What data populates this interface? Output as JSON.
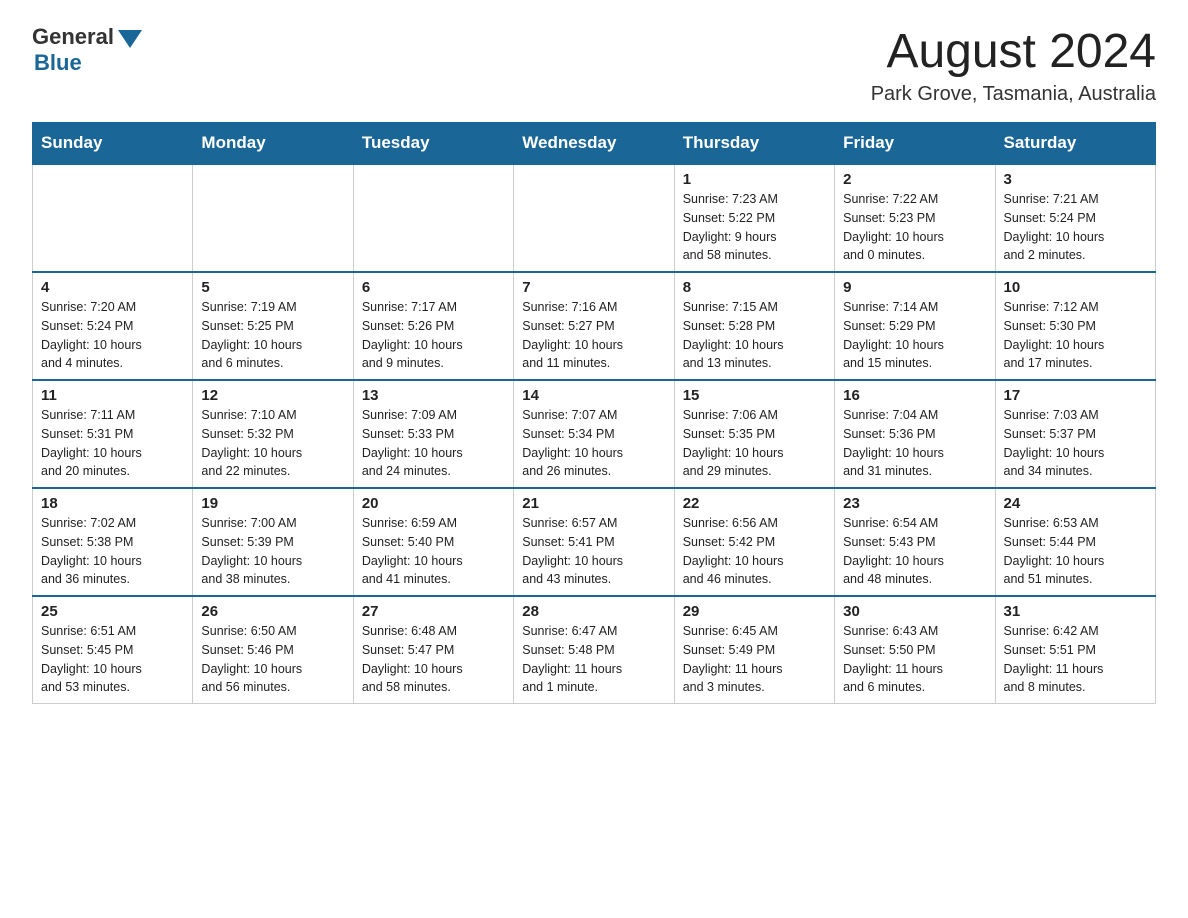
{
  "logo": {
    "general": "General",
    "blue": "Blue"
  },
  "header": {
    "month": "August 2024",
    "location": "Park Grove, Tasmania, Australia"
  },
  "days_of_week": [
    "Sunday",
    "Monday",
    "Tuesday",
    "Wednesday",
    "Thursday",
    "Friday",
    "Saturday"
  ],
  "weeks": [
    [
      {
        "day": "",
        "info": ""
      },
      {
        "day": "",
        "info": ""
      },
      {
        "day": "",
        "info": ""
      },
      {
        "day": "",
        "info": ""
      },
      {
        "day": "1",
        "info": "Sunrise: 7:23 AM\nSunset: 5:22 PM\nDaylight: 9 hours\nand 58 minutes."
      },
      {
        "day": "2",
        "info": "Sunrise: 7:22 AM\nSunset: 5:23 PM\nDaylight: 10 hours\nand 0 minutes."
      },
      {
        "day": "3",
        "info": "Sunrise: 7:21 AM\nSunset: 5:24 PM\nDaylight: 10 hours\nand 2 minutes."
      }
    ],
    [
      {
        "day": "4",
        "info": "Sunrise: 7:20 AM\nSunset: 5:24 PM\nDaylight: 10 hours\nand 4 minutes."
      },
      {
        "day": "5",
        "info": "Sunrise: 7:19 AM\nSunset: 5:25 PM\nDaylight: 10 hours\nand 6 minutes."
      },
      {
        "day": "6",
        "info": "Sunrise: 7:17 AM\nSunset: 5:26 PM\nDaylight: 10 hours\nand 9 minutes."
      },
      {
        "day": "7",
        "info": "Sunrise: 7:16 AM\nSunset: 5:27 PM\nDaylight: 10 hours\nand 11 minutes."
      },
      {
        "day": "8",
        "info": "Sunrise: 7:15 AM\nSunset: 5:28 PM\nDaylight: 10 hours\nand 13 minutes."
      },
      {
        "day": "9",
        "info": "Sunrise: 7:14 AM\nSunset: 5:29 PM\nDaylight: 10 hours\nand 15 minutes."
      },
      {
        "day": "10",
        "info": "Sunrise: 7:12 AM\nSunset: 5:30 PM\nDaylight: 10 hours\nand 17 minutes."
      }
    ],
    [
      {
        "day": "11",
        "info": "Sunrise: 7:11 AM\nSunset: 5:31 PM\nDaylight: 10 hours\nand 20 minutes."
      },
      {
        "day": "12",
        "info": "Sunrise: 7:10 AM\nSunset: 5:32 PM\nDaylight: 10 hours\nand 22 minutes."
      },
      {
        "day": "13",
        "info": "Sunrise: 7:09 AM\nSunset: 5:33 PM\nDaylight: 10 hours\nand 24 minutes."
      },
      {
        "day": "14",
        "info": "Sunrise: 7:07 AM\nSunset: 5:34 PM\nDaylight: 10 hours\nand 26 minutes."
      },
      {
        "day": "15",
        "info": "Sunrise: 7:06 AM\nSunset: 5:35 PM\nDaylight: 10 hours\nand 29 minutes."
      },
      {
        "day": "16",
        "info": "Sunrise: 7:04 AM\nSunset: 5:36 PM\nDaylight: 10 hours\nand 31 minutes."
      },
      {
        "day": "17",
        "info": "Sunrise: 7:03 AM\nSunset: 5:37 PM\nDaylight: 10 hours\nand 34 minutes."
      }
    ],
    [
      {
        "day": "18",
        "info": "Sunrise: 7:02 AM\nSunset: 5:38 PM\nDaylight: 10 hours\nand 36 minutes."
      },
      {
        "day": "19",
        "info": "Sunrise: 7:00 AM\nSunset: 5:39 PM\nDaylight: 10 hours\nand 38 minutes."
      },
      {
        "day": "20",
        "info": "Sunrise: 6:59 AM\nSunset: 5:40 PM\nDaylight: 10 hours\nand 41 minutes."
      },
      {
        "day": "21",
        "info": "Sunrise: 6:57 AM\nSunset: 5:41 PM\nDaylight: 10 hours\nand 43 minutes."
      },
      {
        "day": "22",
        "info": "Sunrise: 6:56 AM\nSunset: 5:42 PM\nDaylight: 10 hours\nand 46 minutes."
      },
      {
        "day": "23",
        "info": "Sunrise: 6:54 AM\nSunset: 5:43 PM\nDaylight: 10 hours\nand 48 minutes."
      },
      {
        "day": "24",
        "info": "Sunrise: 6:53 AM\nSunset: 5:44 PM\nDaylight: 10 hours\nand 51 minutes."
      }
    ],
    [
      {
        "day": "25",
        "info": "Sunrise: 6:51 AM\nSunset: 5:45 PM\nDaylight: 10 hours\nand 53 minutes."
      },
      {
        "day": "26",
        "info": "Sunrise: 6:50 AM\nSunset: 5:46 PM\nDaylight: 10 hours\nand 56 minutes."
      },
      {
        "day": "27",
        "info": "Sunrise: 6:48 AM\nSunset: 5:47 PM\nDaylight: 10 hours\nand 58 minutes."
      },
      {
        "day": "28",
        "info": "Sunrise: 6:47 AM\nSunset: 5:48 PM\nDaylight: 11 hours\nand 1 minute."
      },
      {
        "day": "29",
        "info": "Sunrise: 6:45 AM\nSunset: 5:49 PM\nDaylight: 11 hours\nand 3 minutes."
      },
      {
        "day": "30",
        "info": "Sunrise: 6:43 AM\nSunset: 5:50 PM\nDaylight: 11 hours\nand 6 minutes."
      },
      {
        "day": "31",
        "info": "Sunrise: 6:42 AM\nSunset: 5:51 PM\nDaylight: 11 hours\nand 8 minutes."
      }
    ]
  ]
}
